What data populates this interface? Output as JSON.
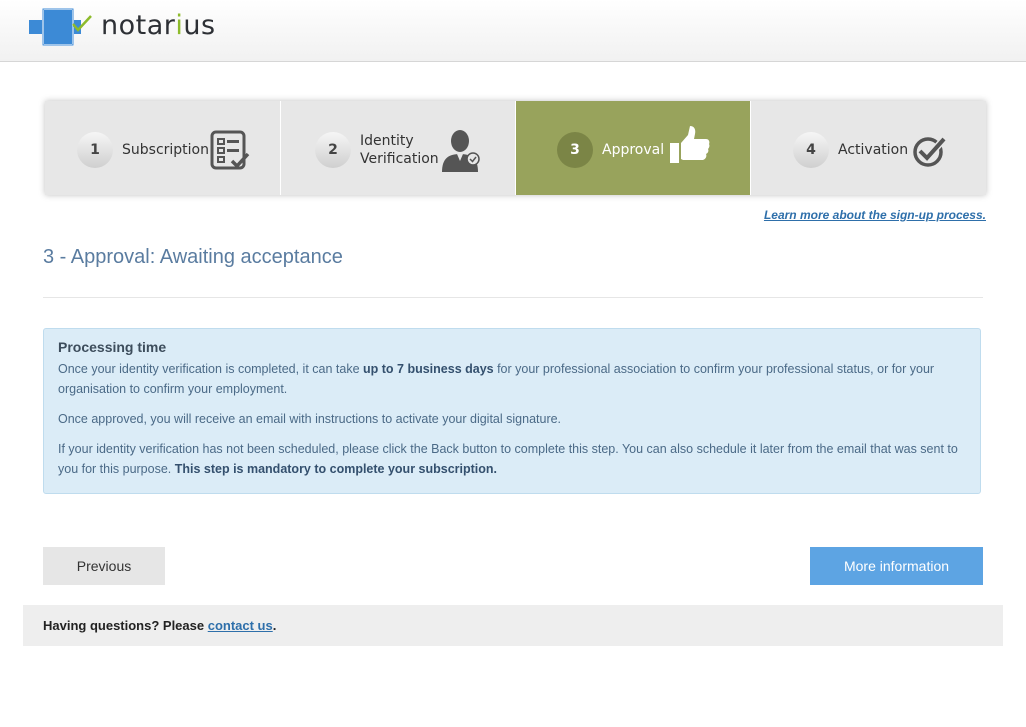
{
  "header": {
    "logo_prefix": "notar",
    "logo_highlight": "i",
    "logo_suffix": "us",
    "brand_blue": "#3c8ad6",
    "brand_green": "#8dbb2b"
  },
  "steps": [
    {
      "number": "1",
      "label": "Subscription",
      "icon": "checklist-icon",
      "active": false
    },
    {
      "number": "2",
      "label_line1": "Identity",
      "label_line2": "Verification",
      "icon": "user-verified-icon",
      "active": false
    },
    {
      "number": "3",
      "label": "Approval",
      "icon": "thumbs-up-icon",
      "active": true
    },
    {
      "number": "4",
      "label": "Activation",
      "icon": "check-circle-icon",
      "active": false
    }
  ],
  "active_color": "#98a35c",
  "learn_more": "Learn more about the sign-up process.",
  "page_title": "3 - Approval: Awaiting acceptance",
  "info": {
    "heading": "Processing time",
    "p1_a": "Once your identity verification is completed, it can take ",
    "p1_bold": "up to 7 business days",
    "p1_b": " for your professional association to confirm your professional status, or for your organisation to confirm your employment.",
    "p2": "Once approved, you will receive an email with instructions to activate your digital signature.",
    "p3_a": "If your identity verification has not been scheduled, please click the Back button to complete this step. You can also schedule it later from the email that was sent to you for this purpose. ",
    "p3_bold": "This step is mandatory to complete your subscription."
  },
  "buttons": {
    "previous": "Previous",
    "more_info": "More information"
  },
  "footer": {
    "text": "Having questions? Please ",
    "link": "contact us",
    "end": "."
  }
}
